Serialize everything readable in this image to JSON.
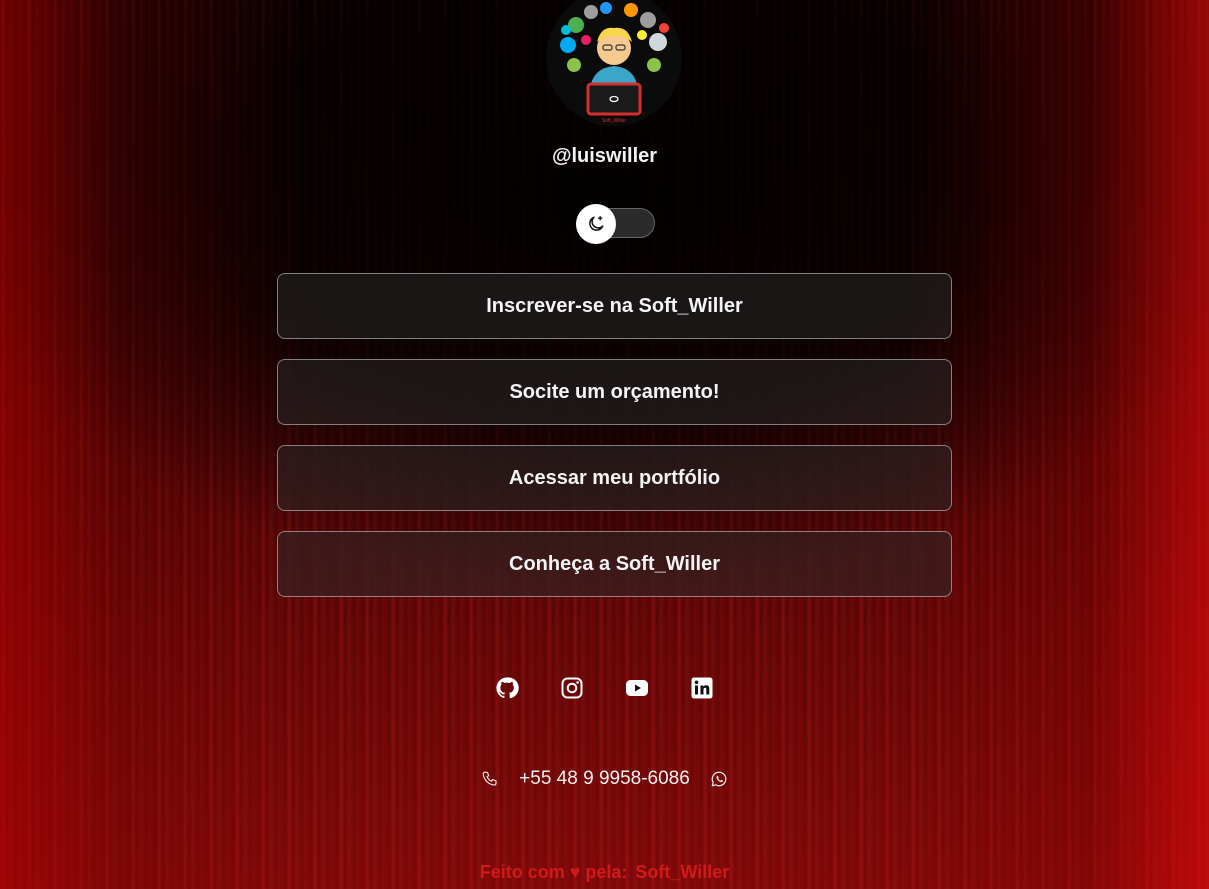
{
  "profile": {
    "handle": "@luiswiller",
    "avatar_icon": "developer-avatar-icon"
  },
  "theme_toggle": {
    "icon": "moon-star-icon",
    "state": "off"
  },
  "links": [
    {
      "label": "Inscrever-se na Soft_Willer"
    },
    {
      "label": "Socite um orçamento!"
    },
    {
      "label": "Acessar meu portfólio"
    },
    {
      "label": "Conheça a Soft_Willer"
    }
  ],
  "socials": [
    {
      "icon": "github-icon"
    },
    {
      "icon": "instagram-icon"
    },
    {
      "icon": "youtube-icon"
    },
    {
      "icon": "linkedin-icon"
    }
  ],
  "contact": {
    "phone_icon": "phone-icon",
    "phone": "+55 48 9 9958-6086",
    "whatsapp_icon": "whatsapp-icon"
  },
  "footer": {
    "text": "Feito com ♥ pela:",
    "brand": "Soft_Willer"
  },
  "colors": {
    "accent": "#d11a1a",
    "text": "#f2f2f2",
    "button_bg": "#282828"
  }
}
